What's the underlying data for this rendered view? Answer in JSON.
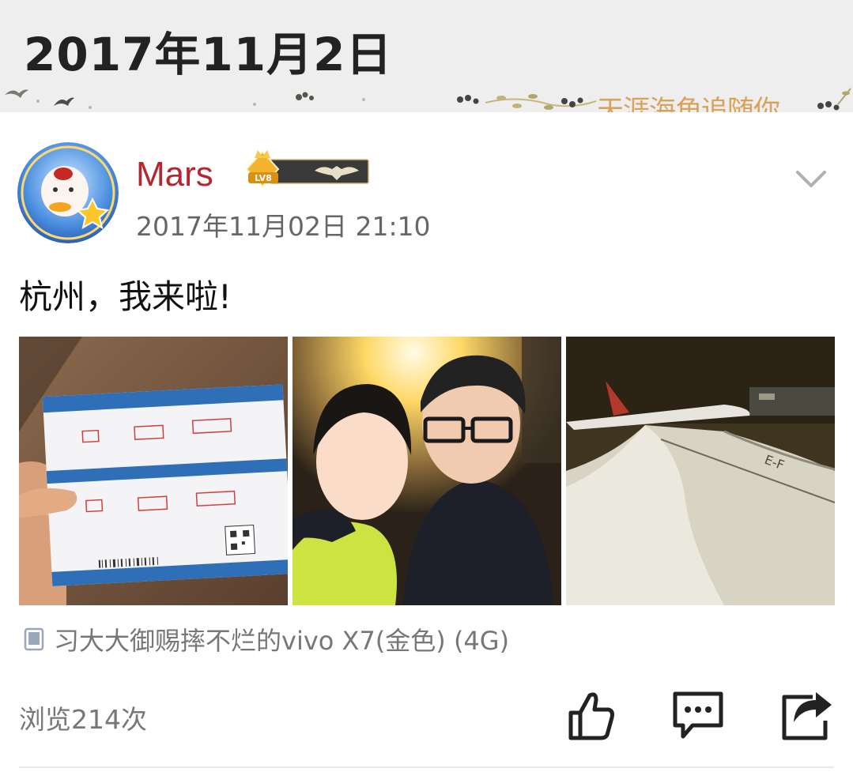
{
  "header": {
    "date": "2017年11月2日",
    "banner_text": "天涯海角追随你"
  },
  "post": {
    "username": "Mars",
    "level_badge": "LV8",
    "timestamp": "2017年11月02日 21:10",
    "text": "杭州，我来啦!",
    "photos": [
      "boarding-pass-photo",
      "couple-selfie-photo",
      "airplane-wing-photo"
    ],
    "device": "习大大御赐摔不烂的vivo X7(金色) (4G)",
    "views": "浏览214次"
  },
  "colors": {
    "username": "#b5262e",
    "header_bg": "#eeeeee",
    "banner": "#d9a25a"
  },
  "icons": [
    "chevron-down-icon",
    "phone-icon",
    "like-icon",
    "comment-icon",
    "share-icon"
  ]
}
